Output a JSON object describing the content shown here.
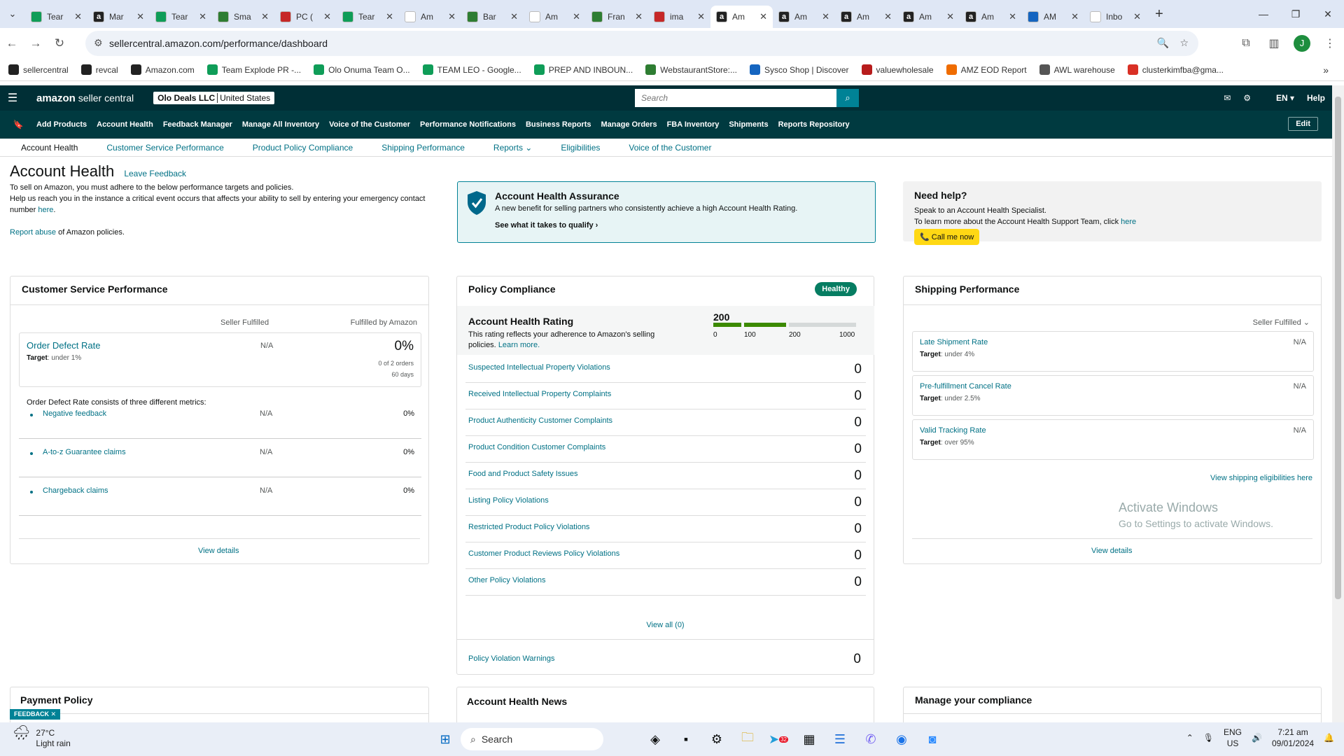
{
  "browser": {
    "tabs": [
      {
        "title": "Tear",
        "icon": "sheets-icon",
        "color": "#0f9d58"
      },
      {
        "title": "Mar",
        "icon": "amazon-icon",
        "color": "#222"
      },
      {
        "title": "Tear",
        "icon": "sheets-icon",
        "color": "#0f9d58"
      },
      {
        "title": "Sma",
        "icon": "webstaurant-icon",
        "color": "#2e7d32"
      },
      {
        "title": "PC (",
        "icon": "email-icon",
        "color": "#c62828"
      },
      {
        "title": "Tear",
        "icon": "sheets-icon",
        "color": "#0f9d58"
      },
      {
        "title": "Am",
        "icon": "amazon-icon",
        "color": "#fff"
      },
      {
        "title": "Bar",
        "icon": "webstaurant-icon",
        "color": "#2e7d32"
      },
      {
        "title": "Am",
        "icon": "amazon-icon",
        "color": "#fff"
      },
      {
        "title": "Fran",
        "icon": "webstaurant-icon",
        "color": "#2e7d32"
      },
      {
        "title": "ima",
        "icon": "red-v-icon",
        "color": "#c62828"
      },
      {
        "title": "Am",
        "icon": "amazon-icon",
        "color": "#222",
        "active": true
      },
      {
        "title": "Am",
        "icon": "amazon-icon",
        "color": "#222"
      },
      {
        "title": "Am",
        "icon": "amazon-icon",
        "color": "#222"
      },
      {
        "title": "Am",
        "icon": "amazon-icon",
        "color": "#222"
      },
      {
        "title": "Am",
        "icon": "amazon-icon",
        "color": "#222"
      },
      {
        "title": "AM",
        "icon": "amz-eod-icon",
        "color": "#1565c0"
      },
      {
        "title": "Inbo",
        "icon": "gmail-icon",
        "color": "#fff"
      }
    ],
    "url": "sellercentral.amazon.com/performance/dashboard",
    "bookmarks": [
      {
        "label": "sellercentral",
        "icon": "amazon-icon"
      },
      {
        "label": "revcal",
        "icon": "amazon-icon"
      },
      {
        "label": "Amazon.com",
        "icon": "amazon-icon"
      },
      {
        "label": "Team Explode PR -...",
        "icon": "sheets-icon"
      },
      {
        "label": "Olo Onuma Team O...",
        "icon": "sheets-icon"
      },
      {
        "label": "TEAM LEO - Google...",
        "icon": "sheets-icon"
      },
      {
        "label": "PREP AND INBOUN...",
        "icon": "sheets-icon"
      },
      {
        "label": "WebstaurantStore:...",
        "icon": "webstaurant-icon"
      },
      {
        "label": "Sysco Shop | Discover",
        "icon": "sysco-icon"
      },
      {
        "label": "valuewholesale",
        "icon": "valuewholesale-icon"
      },
      {
        "label": "AMZ EOD Report",
        "icon": "amz-eod-icon"
      },
      {
        "label": "AWL warehouse",
        "icon": "globe-icon"
      },
      {
        "label": "clusterkimfba@gma...",
        "icon": "gmail-icon"
      }
    ]
  },
  "seller": {
    "brand": "amazon",
    "brand_suffix": " seller central",
    "account_name": "Olo Deals LLC",
    "account_region": "United States",
    "search_placeholder": "Search",
    "lang": "EN",
    "help": "Help",
    "nav": [
      "Add Products",
      "Account Health",
      "Feedback Manager",
      "Manage All Inventory",
      "Voice of the Customer",
      "Performance Notifications",
      "Business Reports",
      "Manage Orders",
      "FBA Inventory",
      "Shipments",
      "Reports Repository"
    ],
    "edit": "Edit",
    "tabs": [
      "Account Health",
      "Customer Service Performance",
      "Product Policy Compliance",
      "Shipping Performance",
      "Reports",
      "Eligibilities",
      "Voice of the Customer"
    ]
  },
  "page": {
    "title": "Account Health",
    "leave_feedback": "Leave Feedback",
    "intro1": "To sell on Amazon, you must adhere to the below performance targets and policies.",
    "intro2": "Help us reach you in the instance a critical event occurs that affects your ability to sell by entering your emergency contact number",
    "intro2_link": "here",
    "report_abuse": "Report abuse",
    "report_abuse_rest": " of Amazon policies.",
    "aha_title": "Account Health Assurance",
    "aha_desc": "A new benefit for selling partners who consistently achieve a high Account Health Rating.",
    "aha_link": "See what it takes to qualify",
    "help_title": "Need help?",
    "help_line1": "Speak to an Account Health Specialist.",
    "help_line2": "To learn more about the Account Health Support Team, click",
    "help_link": "here",
    "call_btn": "Call me now"
  },
  "csp": {
    "title": "Customer Service Performance",
    "col1": "Seller Fulfilled",
    "col2": "Fulfilled by Amazon",
    "odr_name": "Order Defect Rate",
    "odr_target_label": "Target",
    "odr_target": ": under 1%",
    "odr_sf": "N/A",
    "odr_fba": "0%",
    "odr_orders": "0 of 2 orders",
    "odr_days": "60 days",
    "consists": "Order Defect Rate consists of three different metrics:",
    "metrics": [
      {
        "name": "Negative feedback",
        "sf": "N/A",
        "fba": "0%"
      },
      {
        "name": "A-to-z Guarantee claims",
        "sf": "N/A",
        "fba": "0%"
      },
      {
        "name": "Chargeback claims",
        "sf": "N/A",
        "fba": "0%"
      }
    ],
    "view_details": "View details"
  },
  "policy": {
    "title": "Policy Compliance",
    "badge": "Healthy",
    "ahr_title": "Account Health Rating",
    "ahr_desc": "This rating reflects your adherence to Amazon's selling policies.",
    "ahr_link": "Learn more.",
    "ahr_value": "200",
    "ticks": [
      "0",
      "100",
      "200",
      "1000"
    ],
    "rows": [
      {
        "name": "Suspected Intellectual Property Violations",
        "count": "0"
      },
      {
        "name": "Received Intellectual Property Complaints",
        "count": "0"
      },
      {
        "name": "Product Authenticity Customer Complaints",
        "count": "0"
      },
      {
        "name": "Product Condition Customer Complaints",
        "count": "0"
      },
      {
        "name": "Food and Product Safety Issues",
        "count": "0"
      },
      {
        "name": "Listing Policy Violations",
        "count": "0"
      },
      {
        "name": "Restricted Product Policy Violations",
        "count": "0"
      },
      {
        "name": "Customer Product Reviews Policy Violations",
        "count": "0"
      },
      {
        "name": "Other Policy Violations",
        "count": "0"
      }
    ],
    "view_all": "View all (0)",
    "warnings": "Policy Violation Warnings",
    "warnings_count": "0"
  },
  "shipping": {
    "title": "Shipping Performance",
    "filter": "Seller Fulfilled",
    "rows": [
      {
        "name": "Late Shipment Rate",
        "target": ": under 4%",
        "value": "N/A"
      },
      {
        "name": "Pre-fulfillment Cancel Rate",
        "target": ": under 2.5%",
        "value": "N/A"
      },
      {
        "name": "Valid Tracking Rate",
        "target": ": over 95%",
        "value": "N/A"
      }
    ],
    "target_label": "Target",
    "eligibilities": "View shipping eligibilities here",
    "view_details": "View details"
  },
  "bottom": {
    "payment": "Payment Policy",
    "news": "Account Health News",
    "compliance": "Manage your compliance",
    "feedback": "FEEDBACK"
  },
  "overlay": {
    "activate": "Activate Windows",
    "activate_sub": "Go to Settings to activate Windows."
  },
  "taskbar": {
    "temp": "27°C",
    "weather": "Light rain",
    "search": "Search",
    "lang1": "ENG",
    "lang2": "US",
    "time": "7:21 am",
    "date": "09/01/2024",
    "telegram_badge": "32"
  }
}
